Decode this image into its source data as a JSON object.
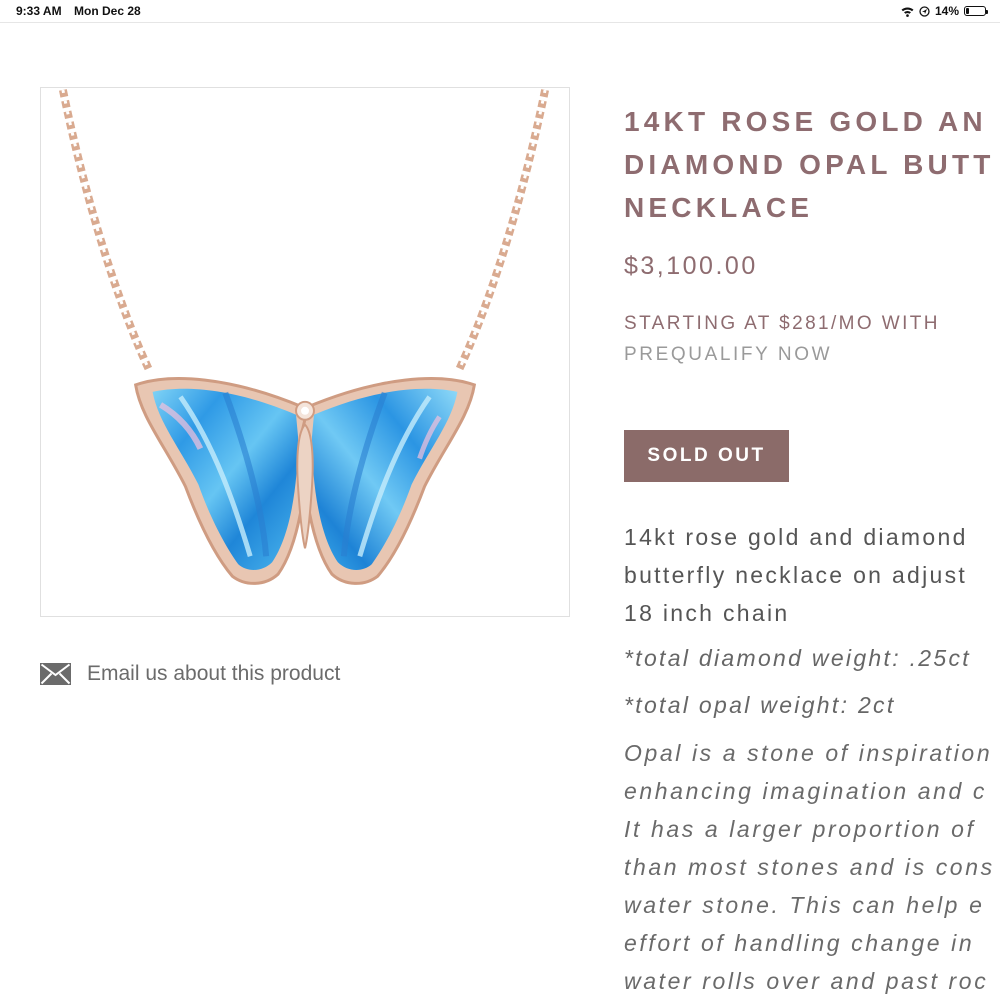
{
  "status_bar": {
    "time": "9:33 AM",
    "date": "Mon Dec 28",
    "battery": "14%",
    "battery_level": 0.14,
    "icons": [
      "wifi-icon",
      "location-icon",
      "battery-icon"
    ]
  },
  "product": {
    "image_alt": "butterfly-necklace-image",
    "title_lines": [
      "14KT ROSE GOLD AN",
      "DIAMOND OPAL BUTT",
      "NECKLACE"
    ],
    "price": "$3,100.00",
    "financing": "STARTING AT $281/MO WITH",
    "prequalify": "PREQUALIFY NOW",
    "sold_out": "SOLD OUT",
    "description_lines": [
      "14kt rose gold and diamond",
      "butterfly necklace on adjust",
      "18 inch chain"
    ],
    "diamond_weight": "*total diamond weight: .25ct",
    "opal_weight": "*total opal weight:  2ct",
    "opal_lines": [
      "Opal is a stone of inspiration",
      "enhancing imagination and c",
      "It has a larger proportion of",
      "than most stones and is cons",
      "water stone. This can help e",
      "effort of handling change in",
      "water rolls over and past roc"
    ]
  },
  "email": {
    "label": "Email us about this product",
    "icon": "envelope-icon"
  },
  "colors": {
    "accent": "#8e6c70",
    "button": "#8b6b69",
    "opal_blue": "#3aa6ea",
    "rose_gold": "#d9a58c"
  }
}
